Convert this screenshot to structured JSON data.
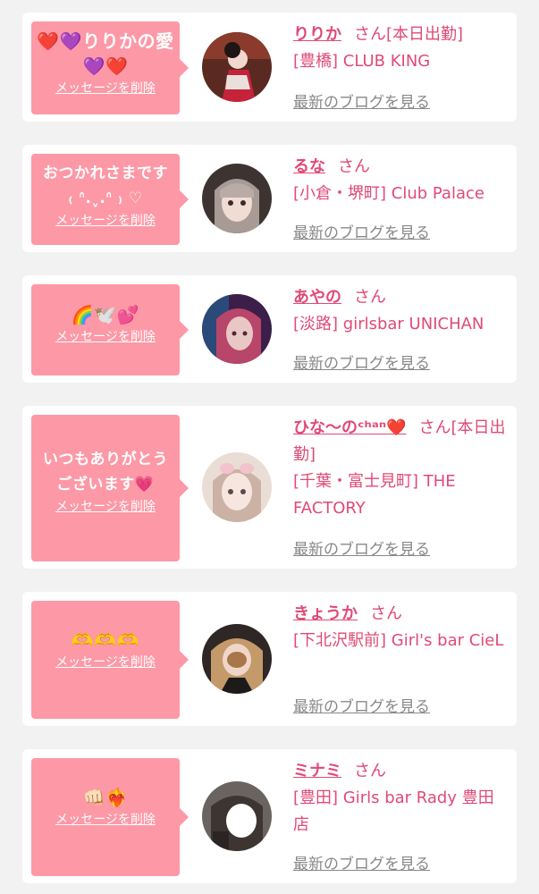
{
  "delete_label": "メッセージを削除",
  "blog_label": "最新のブログを見る",
  "san_label": "さん",
  "cards": [
    {
      "message": "❤️💜りりかの愛\n💜❤️",
      "name": "りりか",
      "suffix": "[本日出勤]",
      "shop": "[豊橋] CLUB KING"
    },
    {
      "message": "おつかれさまです\n₍ ᐢ.ˬ.ᐢ ₎ ♡",
      "name": "るな",
      "suffix": "",
      "shop": "[小倉・堺町] Club Palace"
    },
    {
      "message": "🌈🕊️💕",
      "name": "あやの",
      "suffix": "",
      "shop": "[淡路] girlsbar UNICHAN"
    },
    {
      "message": "いつもありがとう\nございます💗",
      "name": "ひな〜のᶜʰᵃⁿ❤️",
      "suffix": "[本日出勤]",
      "shop": "[千葉・富士見町] THE FACTORY"
    },
    {
      "message": "🫶🫶🫶",
      "name": "きょうか",
      "suffix": "",
      "shop": "[下北沢駅前] Girl's bar CieL"
    },
    {
      "message": "👊🏻❤️‍🔥",
      "name": "ミナミ",
      "suffix": "",
      "shop": "[豊田] Girls bar Rady 豊田店"
    }
  ],
  "colors": {
    "bubble": "#fd98a6",
    "accent": "#e04a76",
    "link_gray": "#888888",
    "background": "#f2f2f2"
  }
}
